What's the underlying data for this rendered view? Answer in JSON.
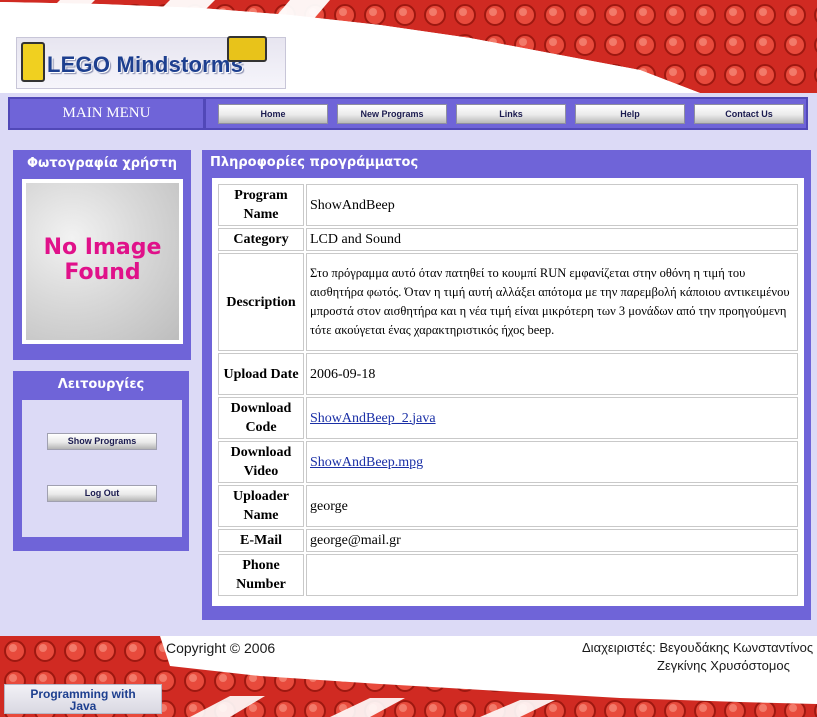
{
  "header": {
    "logo_text": "LEGO Mindstorms"
  },
  "nav": {
    "main_menu": "MAIN MENU",
    "buttons": [
      "Home",
      "New Programs",
      "Links",
      "Help",
      "Contact Us"
    ]
  },
  "sidebar": {
    "photo_title": "Φωτογραφία χρήστη",
    "no_image_line1": "No Image",
    "no_image_line2": "Found",
    "functions_title": "Λειτουργίες",
    "show_programs": "Show Programs",
    "log_out": "Log Out"
  },
  "content": {
    "title": "Πληροφορίες προγράμματος",
    "rows": [
      {
        "label": "Program Name",
        "value": "ShowAndBeep"
      },
      {
        "label": "Category",
        "value": "LCD and Sound"
      },
      {
        "label": "Description",
        "value": "Στο πρόγραμμα αυτό όταν πατηθεί το κουμπί RUN εμφανίζεται στην οθόνη η τιμή του αισθητήρα φωτός. Όταν η τιμή αυτή αλλάξει απότομα με την παρεμβολή κάποιου αντικειμένου μπροστά στον αισθητήρα και η νέα τιμή είναι μικρότερη των 3 μονάδων από την προηγούμενη τότε ακούγεται ένας χαρακτηριστικός ήχος beep."
      },
      {
        "label": "Upload Date",
        "value": "2006-09-18"
      },
      {
        "label": "Download Code",
        "value": "ShowAndBeep_2.java"
      },
      {
        "label": "Download Video",
        "value": "ShowAndBeep.mpg"
      },
      {
        "label": "Uploader Name",
        "value": "george"
      },
      {
        "label": "E-Mail",
        "value": "george@mail.gr"
      },
      {
        "label": "Phone Number",
        "value": ""
      }
    ]
  },
  "footer": {
    "copyright": "Copyright © 2006",
    "admins_label": "Διαχειριστές: Βεγουδάκης Κωνσταντίνος",
    "admin2": "Ζεγκίνης Χρυσόστομος",
    "badge_line1": "Programming with",
    "badge_line2": "Java"
  },
  "colors": {
    "accent": "#6f64d8",
    "page_bg": "#dcdaf6",
    "brick_red": "#d8322a",
    "link": "#1a2fa6",
    "no_image": "#e0118a"
  }
}
